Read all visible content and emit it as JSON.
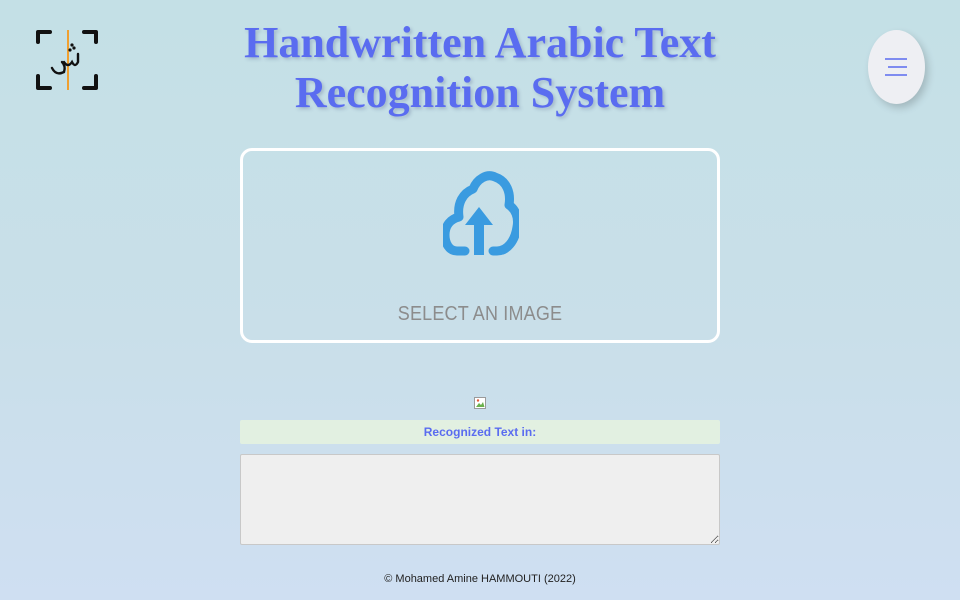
{
  "header": {
    "logo_icon": "scan-frame-arabic-logo-icon",
    "title_line1": "Handwritten Arabic Text",
    "title_line2": "Recognition System",
    "title_color": "#5a6cf0",
    "menu_icon": "hamburger-menu-icon"
  },
  "upload": {
    "icon": "cloud-upload-icon",
    "icon_color": "#3a9be0",
    "label": "SELECT AN IMAGE"
  },
  "preview": {
    "icon": "broken-image-icon"
  },
  "result": {
    "label": "Recognized Text in:",
    "label_bg": "#e2f0e1",
    "text": ""
  },
  "footer": {
    "text": "© Mohamed Amine HAMMOUTI (2022)"
  }
}
